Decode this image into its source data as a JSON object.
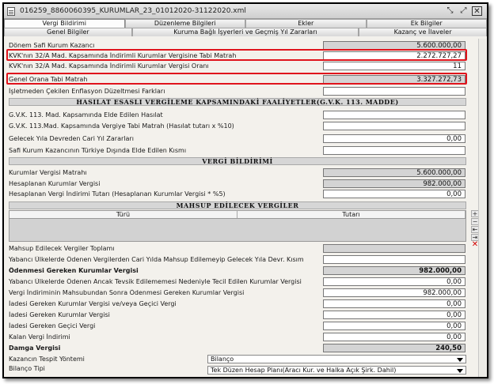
{
  "window": {
    "title": "016259_8860060395_KURUMLAR_23_01012020-31122020.xml",
    "buttons": {
      "resize": "⤡",
      "expand": "⤢",
      "close": "✕"
    }
  },
  "tabs_row1": [
    "Vergi Bildirimi",
    "Düzenleme Bilgileri",
    "Ekler",
    "Ek Bilgiler"
  ],
  "tabs_row2": [
    "Genel Bilgiler",
    "Kuruma Bağlı İşyerleri ve Geçmiş Yıl Zararları",
    "Kazanç ve İlaveler"
  ],
  "rows_top": [
    {
      "label": "Dönem Safi Kurum Kazancı",
      "value": "5.600.000,00",
      "gray": true
    },
    {
      "label": "KVK'nın 32/A Mad. Kapsamında İndirimli Kurumlar Vergisine Tabi Matrah",
      "value": "2.272.727,27",
      "gray": false
    },
    {
      "label": "KVK'nın 32/A Mad. Kapsamında İndirimli Kurumlar Vergisi Oranı",
      "value": "11",
      "gray": false
    },
    {
      "label": "Genel Orana Tabi Matrah",
      "value": "3.327.272,73",
      "gray": true
    },
    {
      "label": "İşletmeden Çekilen Enflasyon Düzeltmesi Farkları",
      "value": "",
      "gray": false
    }
  ],
  "section_hasilat": "HASILAT ESASLI VERGİLEME KAPSAMINDAKİ FAALİYETLER(G.V.K. 113. MADDE)",
  "rows_hasilat": [
    {
      "label": "G.V.K. 113. Mad. Kapsamında Elde Edilen Hasılat",
      "value": ""
    },
    {
      "label": "G.V.K. 113.Mad. Kapsamında Vergiye Tabi Matrah (Hasılat tutarı x %10)",
      "value": ""
    },
    {
      "label": "Gelecek Yıla Devreden Cari Yıl Zararları",
      "value": "0,00"
    },
    {
      "label": "Safi Kurum Kazancının Türkiye Dışında Elde Edilen Kısmı",
      "value": ""
    }
  ],
  "section_vergi": "VERGİ BİLDİRİMİ",
  "rows_vergi": [
    {
      "label": "Kurumlar Vergisi Matrahı",
      "value": "5.600.000,00",
      "gray": true
    },
    {
      "label": "Hesaplanan Kurumlar Vergisi",
      "value": "982.000,00",
      "gray": true
    },
    {
      "label": "Hesaplanan Vergi İndirimi Tutarı (Hesaplanan Kurumlar Vergisi * %5)",
      "value": "0,00",
      "gray": false
    }
  ],
  "section_mahsup": "MAHSUP EDİLECEK VERGİLER",
  "grid": {
    "col1": "Türü",
    "col2": "Tutarı"
  },
  "grid_tools": [
    "+",
    "−",
    "⇤",
    "⇥",
    "✕"
  ],
  "rows_bottom": [
    {
      "label": "Mahsup Edilecek Vergiler Toplamı",
      "value": "",
      "gray": true,
      "bold": false
    },
    {
      "label": "Yabancı Ülkelerde Ödenen Vergilerden Cari Yılda Mahsup Edilemeyip Gelecek Yıla Devr. Kısım",
      "value": "",
      "gray": false,
      "bold": false
    },
    {
      "label": "Ödenmesi Gereken Kurumlar Vergisi",
      "value": "982.000,00",
      "gray": true,
      "bold": true
    },
    {
      "label": "Yabancı Ülkelerde Ödenen Ancak Tevsik Edilememesi Nedeniyle Tecil Edilen Kurumlar Vergisi",
      "value": "0,00",
      "gray": false,
      "bold": false
    },
    {
      "label": "Vergi İndiriminin Mahsubundan Sonra Ödenmesi Gereken Kurumlar Vergisi",
      "value": "982.000,00",
      "gray": false,
      "bold": false
    },
    {
      "label": "İadesi Gereken Kurumlar Vergisi ve/veya Geçici Vergi",
      "value": "0,00",
      "gray": false,
      "bold": false
    },
    {
      "label": "İadesi Gereken Kurumlar Vergisi",
      "value": "0,00",
      "gray": false,
      "bold": false
    },
    {
      "label": "İadesi Gereken Geçici Vergi",
      "value": "0,00",
      "gray": false,
      "bold": false
    },
    {
      "label": "Kalan Vergi İndirimi",
      "value": "0,00",
      "gray": false,
      "bold": false
    },
    {
      "label": "Damga Vergisi",
      "value": "240,50",
      "gray": true,
      "bold": true
    }
  ],
  "selects": [
    {
      "label": "Kazancın Tespit Yöntemi",
      "value": "Bilanço"
    },
    {
      "label": "Bilanço Tipi",
      "value": "Tek Düzen Hesap Planı(Aracı Kur. ve Halka Açık Şirk. Dahil)"
    }
  ],
  "colors": {
    "highlight": "#e0141c",
    "readonly_field": "#d4d4d4"
  }
}
